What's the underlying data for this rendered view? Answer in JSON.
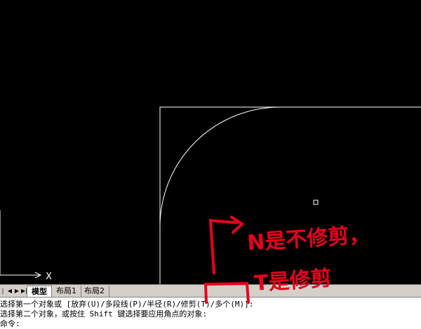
{
  "tabs": {
    "model": "模型",
    "layout1": "布局1",
    "layout2": "布局2"
  },
  "ucs": {
    "x_label": "X"
  },
  "command": {
    "line1": "选择第一个对象或 [放弃(U)/多段线(P)/半径(R)/修剪(T)/多个(M)]:",
    "line2": "选择第二个对象，或按住 Shift 键选择要应用角点的对象:",
    "line3": "命令:"
  },
  "annotation": {
    "line1": "N是不修剪，",
    "line2": "T是修剪",
    "arrow": "|‾‾>"
  },
  "colors": {
    "canvas": "#000000",
    "geometry": "#ffffff",
    "annotation": "#e8001c",
    "tabbar": "#d4d0c8"
  }
}
